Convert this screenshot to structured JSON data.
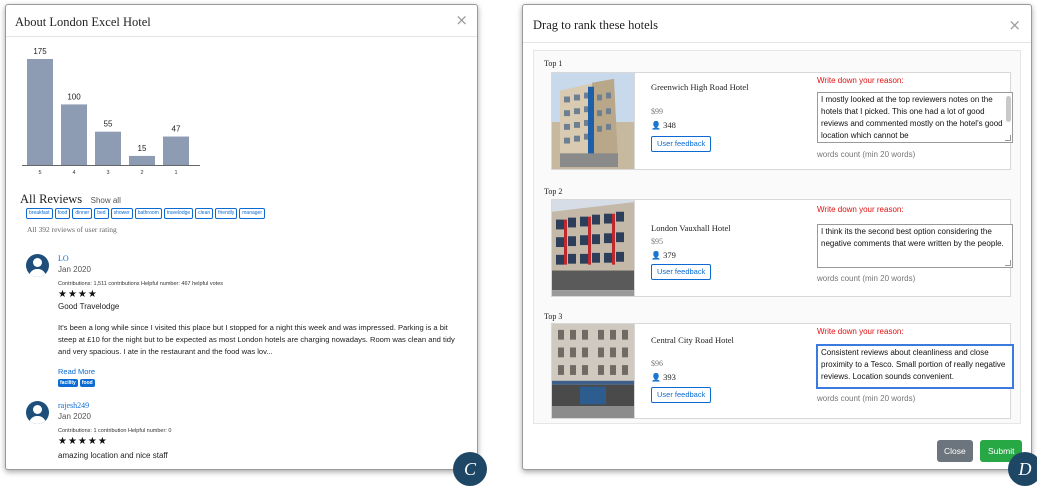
{
  "left_panel": {
    "title": "About London Excel Hotel",
    "close_symbol": "×",
    "rating_chart": {
      "categories": [
        "5",
        "4",
        "3",
        "2",
        "1"
      ],
      "values": [
        175,
        100,
        55,
        15,
        47
      ],
      "bar_color": "#8e9cb3"
    },
    "reviews_title": "All Reviews",
    "show_all": "Show all",
    "tags": [
      "breakfast",
      "food",
      "dinner",
      "bed",
      "shower",
      "bathroom",
      "travelodge",
      "clean",
      "friendly",
      "manager"
    ],
    "total_note": "All 392 reviews of user rating",
    "reviews": [
      {
        "name": "LO",
        "date": "Jan 2020",
        "meta": "Contributions: 1,511 contributions     Helpful number: 467 helpful votes",
        "stars": "★★★★",
        "title": "Good Travelodge",
        "text": "It's been a long while since I visited this place but I stopped for a night this week and was impressed. Parking is a bit steep at £10 for the night but to be expected as most London hotels are charging nowadays. Room was clean and tidy and very spacious. I ate in the restaurant and the food was lov...",
        "read_more": "Read More",
        "badges": [
          "facility",
          "food"
        ]
      },
      {
        "name": "rajesh249",
        "date": "Jan 2020",
        "meta": "Contributions: 1 contribution     Helpful number: 0",
        "stars": "★★★★★",
        "title": "amazing location and nice staff"
      }
    ],
    "corner_label": "C"
  },
  "right_panel": {
    "title": "Drag to rank these hotels",
    "close_symbol": "×",
    "reason_label": "Write down your reason:",
    "words_note": "words count (min 20 words)",
    "feedback_label": "User feedback",
    "ranks": [
      {
        "rank_label": "Top 1",
        "hotel_name": "Greenwich High Road Hotel",
        "price": "$99",
        "count": "348",
        "reason": "I mostly looked at the top reviewers notes on the hotels that I picked. This one had a lot of good reviews and commented mostly on the hotel's good location which cannot be"
      },
      {
        "rank_label": "Top 2",
        "hotel_name": "London Vauxhall Hotel",
        "price": "$95",
        "count": "379",
        "reason": "I think its the second best option considering the negative comments that were written by the people."
      },
      {
        "rank_label": "Top 3",
        "hotel_name": "Central City Road Hotel",
        "price": "$96",
        "count": "393",
        "reason": "Consistent reviews about cleanliness and close proximity to a Tesco. Small portion of really negative reviews. Location sounds convenient."
      }
    ],
    "close_button": "Close",
    "submit_button": "Submit",
    "corner_label": "D"
  }
}
